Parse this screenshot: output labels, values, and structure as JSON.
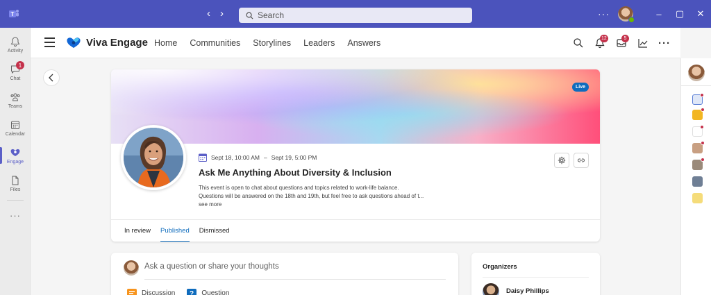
{
  "titlebar": {
    "search_placeholder": "Search",
    "more_label": "···",
    "minimize": "–",
    "maximize": "▢",
    "close": "✕"
  },
  "rail": {
    "items": [
      {
        "label": "Activity",
        "icon": "bell-icon"
      },
      {
        "label": "Chat",
        "icon": "chat-icon",
        "badge": "1"
      },
      {
        "label": "Teams",
        "icon": "teams-icon"
      },
      {
        "label": "Calendar",
        "icon": "calendar-icon"
      },
      {
        "label": "Engage",
        "icon": "engage-icon"
      },
      {
        "label": "Files",
        "icon": "file-icon"
      }
    ],
    "more": "···"
  },
  "header": {
    "app_title": "Viva Engage",
    "nav": [
      "Home",
      "Communities",
      "Storylines",
      "Leaders",
      "Answers"
    ],
    "notifications_badge": "12",
    "inbox_badge": "5",
    "more": "···"
  },
  "event": {
    "live_label": "Live",
    "date_range_start": "Sept 18, 10:00 AM",
    "date_range_sep": "–",
    "date_range_end": "Sept 19, 5:00 PM",
    "title": "Ask Me Anything About Diversity & Inclusion",
    "desc_line1": "This event is open to chat about questions and topics related to work-life balance.",
    "desc_line2": "Questions will be answered on the 18th and 19th, but feel free to ask questions ahead of t...",
    "see_more": "see more",
    "tabs": [
      "In review",
      "Published",
      "Dismissed"
    ],
    "active_tab": "Published"
  },
  "compose": {
    "placeholder": "Ask a question or share your thoughts",
    "options": [
      "Discussion",
      "Question"
    ]
  },
  "organizers": {
    "title": "Organizers",
    "people": [
      "Daisy Phillips"
    ]
  },
  "colors": {
    "teams_purple": "#4b53bc",
    "accent_blue": "#0f6cbd",
    "badge_red": "#c4314b"
  }
}
